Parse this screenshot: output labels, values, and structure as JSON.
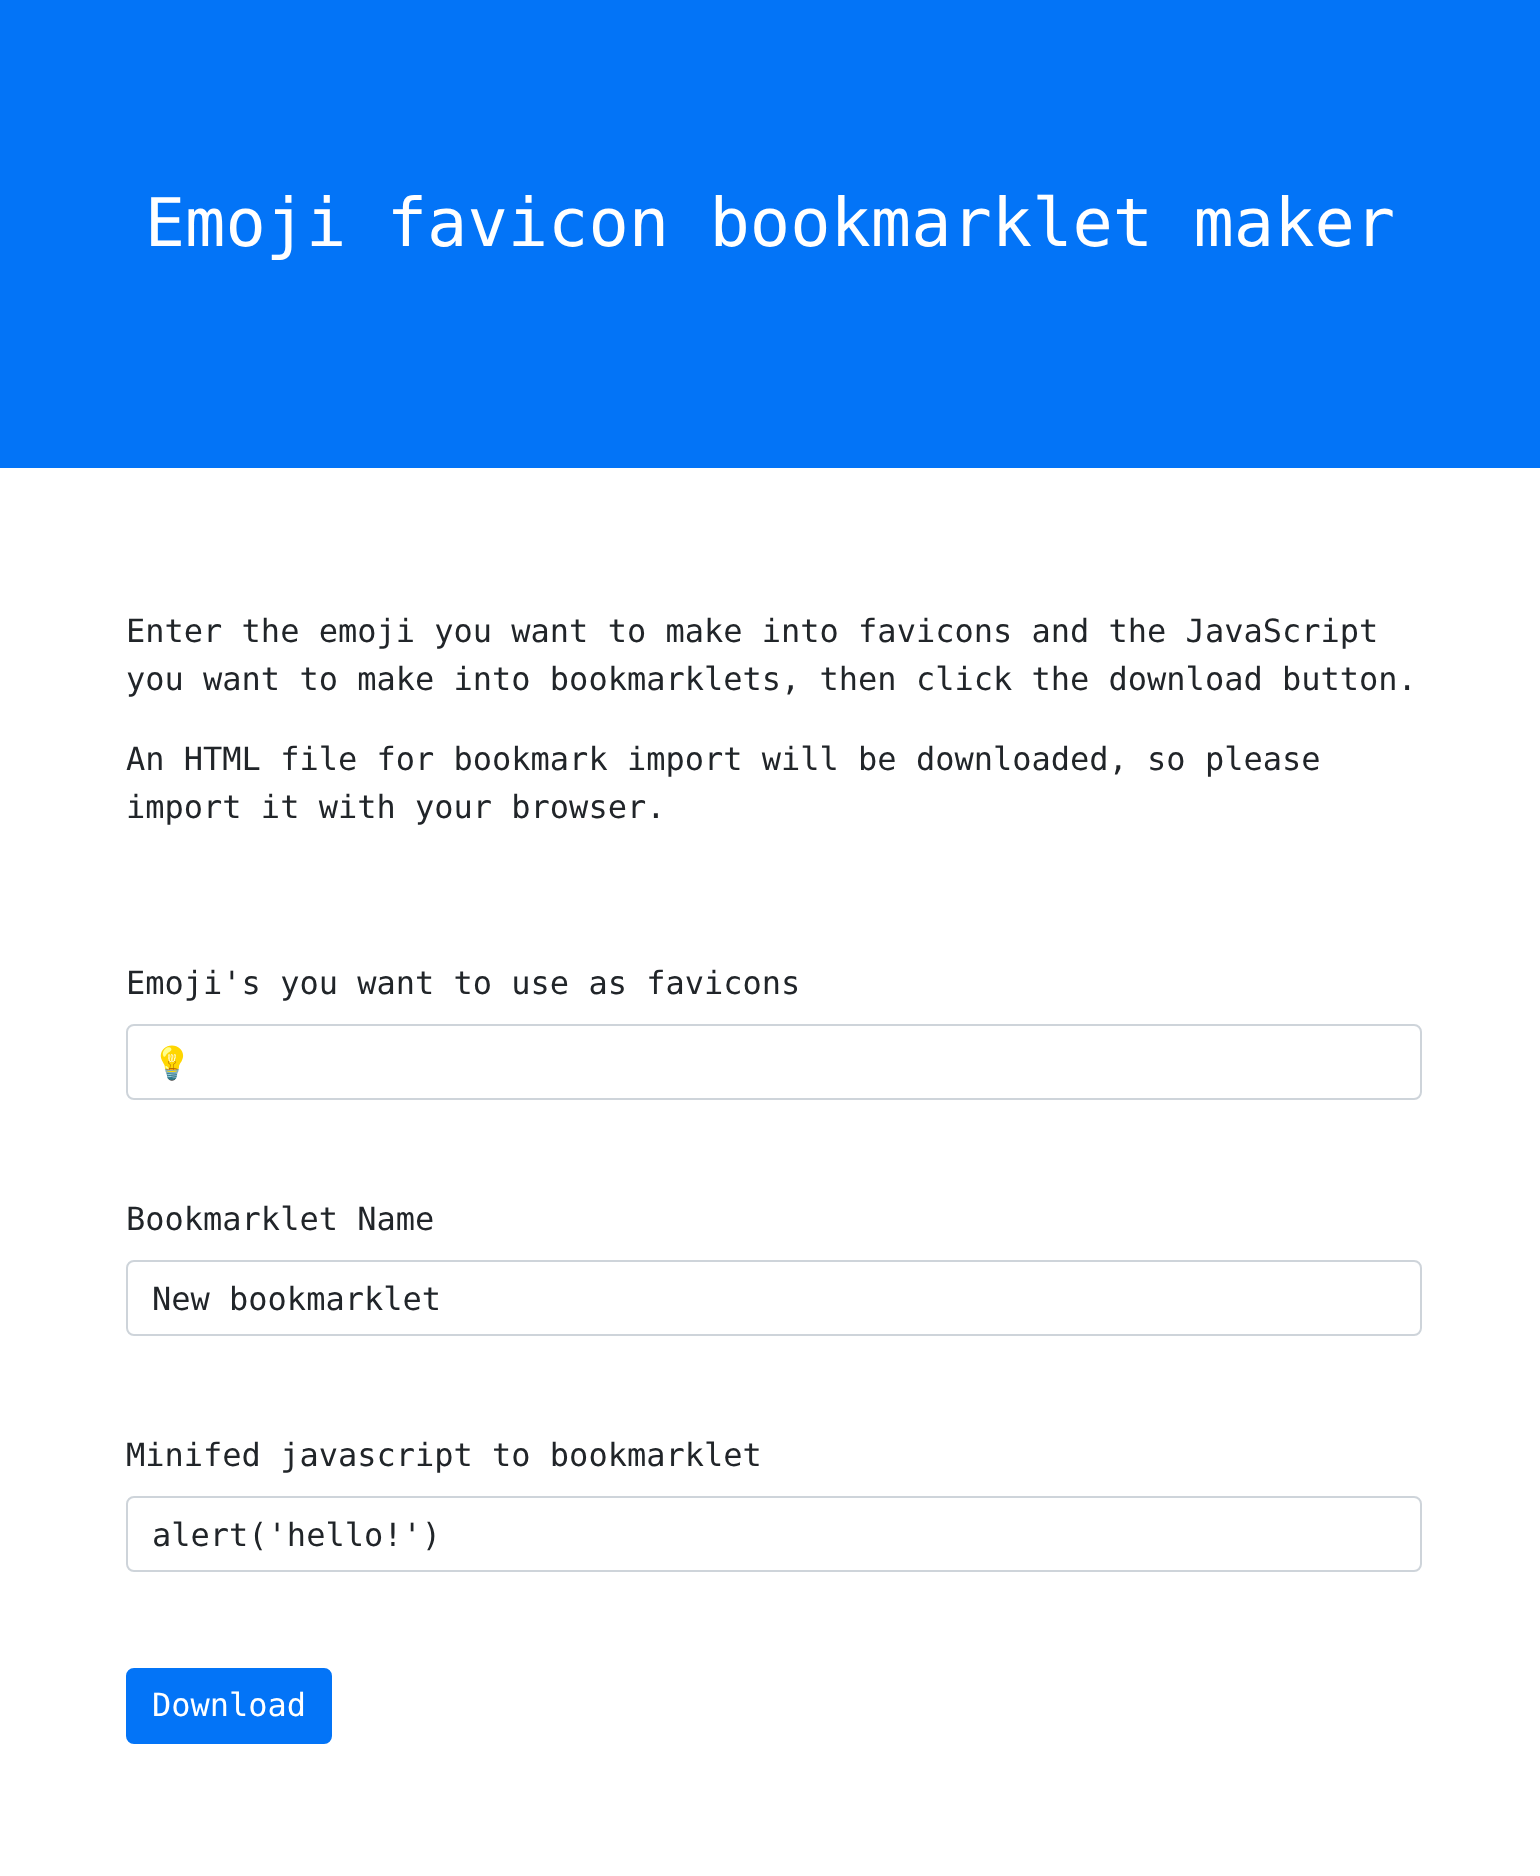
{
  "header": {
    "title": "Emoji favicon bookmarklet maker"
  },
  "intro": [
    "Enter the emoji you want to make into favicons and the JavaScript you want to make into bookmarklets, then click the download button.",
    "An HTML file for bookmark import will be downloaded, so please import it with your browser."
  ],
  "fields": [
    {
      "label": "Emoji's you want to use as favicons",
      "value": "💡"
    },
    {
      "label": "Bookmarklet Name",
      "value": "New bookmarklet"
    },
    {
      "label": "Minifed javascript to bookmarklet",
      "value": "alert('hello!')"
    }
  ],
  "button": {
    "label": "Download"
  }
}
